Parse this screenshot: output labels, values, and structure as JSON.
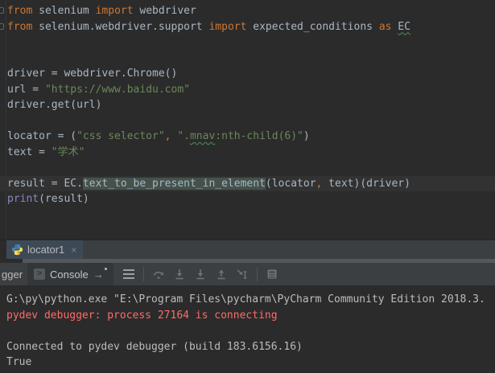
{
  "colors": {
    "editor_bg": "#2b2b2b",
    "panel_bg": "#3c3f41",
    "selected_tab_bg": "#3e4956",
    "caret_row_bg": "#323232",
    "identifier_highlight_bg": "#44524b",
    "keyword": "#cc7832",
    "plain_text": "#a9b7c6",
    "string": "#6a8759",
    "builtin": "#8888c6",
    "stderr_red": "#ff6b68",
    "console_text": "#bcbcbc"
  },
  "icons": {
    "python-icon": "python-logo",
    "close-icon": "×",
    "console-prompt-icon": ">",
    "scroll-to-end-icon": "→",
    "layout-menu-icon": "≡",
    "step-over-icon": "arc-arrow",
    "step-into-icon": "down-arrow-to-line",
    "step-into-my-code-icon": "down-arrow-to-line",
    "step-out-icon": "up-arrow-from-line",
    "run-to-cursor-icon": "arrow-to-ibeam",
    "evaluate-expression-icon": "calculator-grid"
  },
  "editor": {
    "lines": [
      {
        "segments": [
          {
            "t": "from",
            "c": "kw"
          },
          {
            "t": " selenium ",
            "c": "plain"
          },
          {
            "t": "import",
            "c": "kw"
          },
          {
            "t": " webdriver",
            "c": "plain"
          }
        ]
      },
      {
        "segments": [
          {
            "t": "from",
            "c": "kw"
          },
          {
            "t": " selenium.webdriver.support ",
            "c": "plain"
          },
          {
            "t": "import",
            "c": "kw"
          },
          {
            "t": " expected_conditions ",
            "c": "plain"
          },
          {
            "t": "as",
            "c": "kw"
          },
          {
            "t": " ",
            "c": "plain"
          },
          {
            "t": "EC",
            "c": "sq"
          }
        ]
      },
      {
        "segments": []
      },
      {
        "segments": []
      },
      {
        "segments": [
          {
            "t": "driver = webdriver.Chrome()",
            "c": "plain"
          }
        ]
      },
      {
        "segments": [
          {
            "t": "url = ",
            "c": "plain"
          },
          {
            "t": "\"https://www.baidu.com\"",
            "c": "str"
          }
        ]
      },
      {
        "segments": [
          {
            "t": "driver.get(url)",
            "c": "plain"
          }
        ]
      },
      {
        "segments": []
      },
      {
        "segments": [
          {
            "t": "locator = (",
            "c": "plain"
          },
          {
            "t": "\"css selector\"",
            "c": "str"
          },
          {
            "t": ",",
            "c": "kw"
          },
          {
            "t": " ",
            "c": "plain"
          },
          {
            "t": "\".",
            "c": "str"
          },
          {
            "t": "mnav",
            "c": "sqstr"
          },
          {
            "t": ":nth-child(6)\"",
            "c": "str"
          },
          {
            "t": ")",
            "c": "plain"
          }
        ]
      },
      {
        "segments": [
          {
            "t": "text = ",
            "c": "plain"
          },
          {
            "t": "\"学术\"",
            "c": "str"
          }
        ]
      },
      {
        "segments": []
      },
      {
        "caret": true,
        "segments": [
          {
            "t": "result = EC.",
            "c": "plain"
          },
          {
            "t": "text_to_be_present_in_element",
            "c": "hl"
          },
          {
            "t": "(locator",
            "c": "plain"
          },
          {
            "t": ",",
            "c": "kw"
          },
          {
            "t": " text)(driver)",
            "c": "plain"
          }
        ]
      },
      {
        "segments": [
          {
            "t": "print",
            "c": "builtin"
          },
          {
            "t": "(result)",
            "c": "plain"
          }
        ]
      }
    ]
  },
  "debug": {
    "session_tab": {
      "label": "locator1",
      "close_glyph": "×"
    },
    "debugger_tab_partial": "gger",
    "console_tab": {
      "label": "Console",
      "prompt_glyph": ">",
      "scroll_glyph": "→"
    }
  },
  "console": {
    "lines": [
      {
        "segments": [
          {
            "t": "G:\\py\\python.exe \"E:\\Program Files\\pycharm\\PyCharm Community Edition 2018.3.",
            "c": "con"
          }
        ]
      },
      {
        "segments": [
          {
            "t": "pydev debugger: process 27164 is connecting",
            "c": "red"
          }
        ]
      },
      {
        "segments": []
      },
      {
        "segments": [
          {
            "t": "Connected to pydev debugger (build 183.6156.16)",
            "c": "con"
          }
        ]
      },
      {
        "segments": [
          {
            "t": "True",
            "c": "con"
          }
        ]
      }
    ]
  }
}
